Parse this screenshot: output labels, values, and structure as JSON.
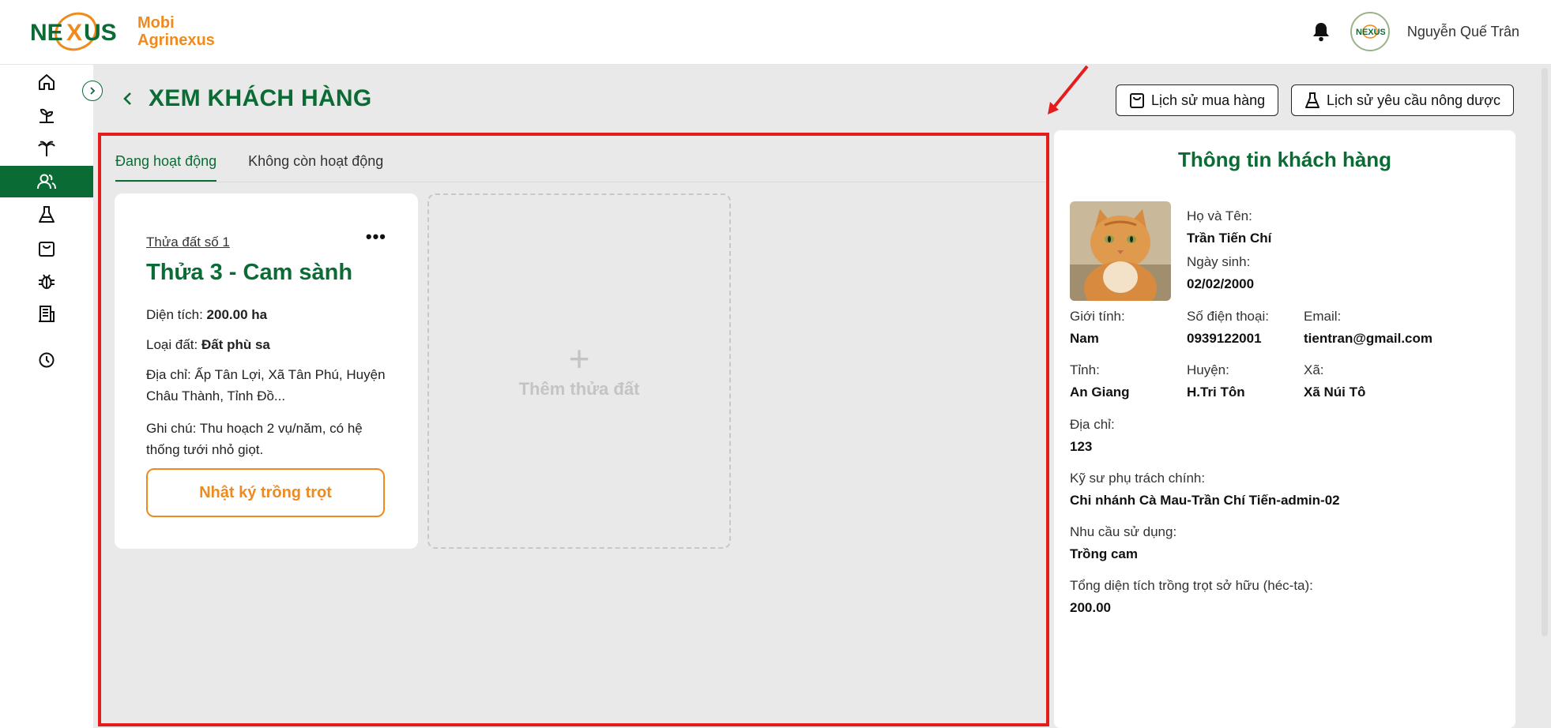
{
  "app": {
    "brand_line1": "Mobi",
    "brand_line2": "Agrinexus",
    "user_name": "Nguyễn Quế Trân",
    "accent": "#0b6b35",
    "orange": "#f08a1c"
  },
  "sidebar": {
    "items": [
      {
        "icon": "home-icon"
      },
      {
        "icon": "sprout-icon"
      },
      {
        "icon": "palm-tree-icon"
      },
      {
        "icon": "customers-icon"
      },
      {
        "icon": "flask-icon"
      },
      {
        "icon": "shopping-bag-icon"
      },
      {
        "icon": "bug-icon"
      },
      {
        "icon": "building-icon"
      },
      {
        "icon": "history-icon"
      }
    ],
    "active": "customers-icon"
  },
  "page": {
    "title": "XEM KHÁCH HÀNG",
    "btn_purchase_history": "Lịch sử mua hàng",
    "btn_pesticide_history": "Lịch sử yêu cầu nông dược"
  },
  "tabs": [
    {
      "label": "Đang hoạt động",
      "active": true
    },
    {
      "label": "Không còn hoạt động",
      "active": false
    }
  ],
  "land": {
    "subtitle": "Thửa đất số 1",
    "title": "Thửa 3 - Cam sành",
    "area_label": "Diện tích: ",
    "area_value": "200.00 ha",
    "soil_label": "Loại đất: ",
    "soil_value": "Đất phù sa",
    "address": "Địa chỉ: Ấp Tân Lợi, Xã Tân Phú, Huyện Châu Thành, Tỉnh Đồ...",
    "note": "Ghi chú: Thu hoạch 2 vụ/năm, có hệ thống tưới nhỏ giọt.",
    "diary_button": "Nhật ký trồng trọt",
    "add_label": "Thêm thửa đất",
    "add_plus": "+"
  },
  "customer": {
    "panel_title": "Thông tin khách hàng",
    "name_label": "Họ và Tên:",
    "name": "Trần Tiến Chí",
    "dob_label": "Ngày sinh:",
    "dob": "02/02/2000",
    "gender_label": "Giới tính:",
    "gender": "Nam",
    "phone_label": "Số điện thoại:",
    "phone": "0939122001",
    "email_label": "Email:",
    "email": "tientran@gmail.com",
    "province_label": "Tỉnh:",
    "province": "An Giang",
    "district_label": "Huyện:",
    "district": "H.Tri Tôn",
    "ward_label": "Xã:",
    "ward": "Xã Núi Tô",
    "address_label": "Địa chỉ:",
    "address": "123",
    "engineer_label": "Kỹ sư phụ trách chính:",
    "engineer": "Chi nhánh Cà Mau-Trần Chí Tiến-admin-02",
    "need_label": "Nhu cầu sử dụng:",
    "need": "Trồng cam",
    "total_area_label": "Tổng diện tích trồng trọt sở hữu (héc-ta):",
    "total_area": "200.00"
  }
}
